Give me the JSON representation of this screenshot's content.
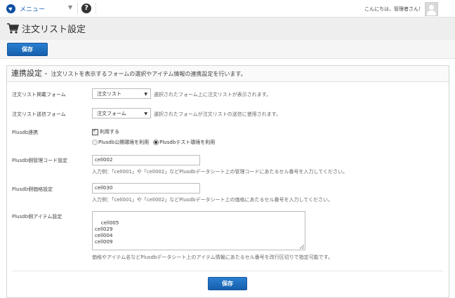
{
  "topbar": {
    "menu_label": "メニュー",
    "help_symbol": "?",
    "greeting": "こんにちは、管理者さん！",
    "accent": "#0a4fa0"
  },
  "page": {
    "title": "注文リスト設定",
    "save_label": "保存"
  },
  "panel": {
    "title": "連携設定 -",
    "subtitle": "注文リストを表示するフォームの選択やアイテム情報の連携設定を行います。",
    "fields": {
      "display_form": {
        "label": "注文リスト掲載フォーム",
        "value": "注文リスト",
        "hint": "選択されたフォーム上に注文リストが表示されます。"
      },
      "send_form": {
        "label": "注文リスト送信フォーム",
        "value": "注文フォーム",
        "hint": "選択されたフォームが注文リストの送信に使用されます。"
      },
      "plusdb": {
        "label": "Plusdb連携",
        "checkbox_label": "利用する",
        "checkbox_checked": true,
        "radio_public": "Plusdb公開環境を利用",
        "radio_test": "Plusdbテスト環境を利用",
        "selected": "test"
      },
      "code": {
        "label": "Plusdb側管理コード設定",
        "value": "cell002",
        "hint": "入力例：「cell001」や「cell002」などPlusdbデータシート上の管理コードにあたるセル番号を入力してください。"
      },
      "price": {
        "label": "Plusdb側価格設定",
        "value": "cell030",
        "hint": "入力例：「cell001」や「cell002」などPlusdbデータシート上の価格にあたるセル番号を入力してください。"
      },
      "items": {
        "label": "Plusdb側アイテム設定",
        "value": "cell005\ncell029\ncell004\ncell009",
        "hint": "価格やアイテム名などPlusdbデータシート上のアイテム情報にあたるセル番号を改行区切りで指定可能です。"
      }
    }
  }
}
